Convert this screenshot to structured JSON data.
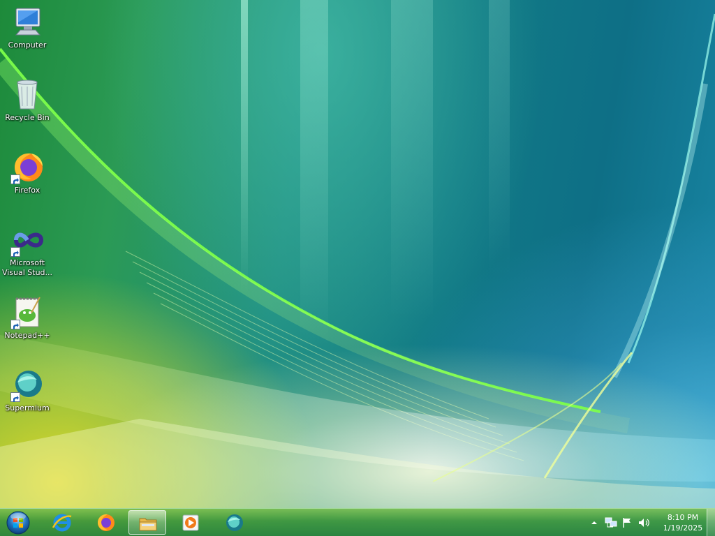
{
  "desktop": {
    "icons": [
      {
        "label": "Computer",
        "icon": "computer-icon"
      },
      {
        "label": "Recycle Bin",
        "icon": "recycle-bin-icon"
      },
      {
        "label": "Firefox",
        "icon": "firefox-icon"
      },
      {
        "label": "Microsoft Visual Stud...",
        "icon": "visual-studio-icon"
      },
      {
        "label": "Notepad++",
        "icon": "notepadpp-icon"
      },
      {
        "label": "Supermium",
        "icon": "supermium-icon"
      }
    ]
  },
  "taskbar": {
    "pinned": [
      {
        "icon": "internet-explorer-icon"
      },
      {
        "icon": "firefox-icon"
      },
      {
        "icon": "file-explorer-icon",
        "active": true
      },
      {
        "icon": "media-player-icon"
      },
      {
        "icon": "supermium-icon"
      }
    ],
    "tray": {
      "icons": [
        "show-hidden-icons-icon",
        "network-icon",
        "action-center-flag-icon",
        "volume-icon"
      ]
    },
    "clock": {
      "time": "8:10 PM",
      "date": "1/19/2025"
    }
  },
  "colors": {
    "taskbar": "#3c963c",
    "label_text": "#ffffff"
  }
}
